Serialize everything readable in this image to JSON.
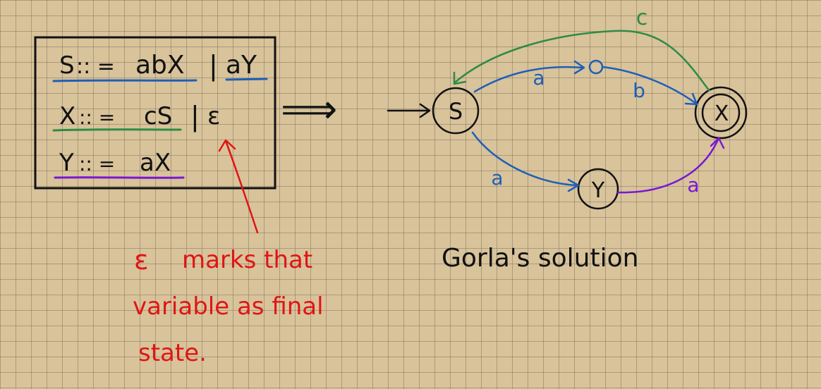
{
  "grammar": {
    "rule_s": {
      "lhs": "S",
      "def": ":: =",
      "opt1": "abX",
      "sep": "|",
      "opt2": "aY"
    },
    "rule_x": {
      "lhs": "X",
      "def": ":: =",
      "opt1": "cS",
      "sep": "|",
      "opt2": "ε"
    },
    "rule_y": {
      "lhs": "Y",
      "def": ":: =",
      "opt1": "aX"
    }
  },
  "implies_symbol": "⟹",
  "annotation": {
    "epsilon": "ε",
    "line1": "marks that",
    "line2": "variable as final",
    "line3": "state."
  },
  "automaton": {
    "states": {
      "s": "S",
      "x": "X",
      "y": "Y"
    },
    "edges": {
      "s_to_mid": "a",
      "mid_to_x": "b",
      "x_to_s": "c",
      "s_to_y": "a",
      "y_to_x": "a"
    }
  },
  "caption": "Gorla's solution",
  "colors": {
    "blue": "#1f5fb8",
    "green": "#2e8b45",
    "purple": "#7a16d6",
    "red": "#e01515",
    "ink": "#111111"
  }
}
